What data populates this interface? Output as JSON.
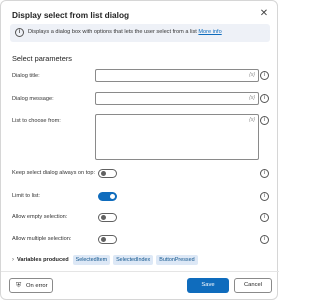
{
  "dialog": {
    "title": "Display select from list dialog",
    "close_icon": "close-icon"
  },
  "banner": {
    "icon": "info-icon",
    "text": "Displays a dialog box with options that lets the user select from a list",
    "link": "More info"
  },
  "section_title": "Select parameters",
  "fields": {
    "dialog_title": {
      "label": "Dialog title:",
      "value": "",
      "fx": "{x}"
    },
    "dialog_message": {
      "label": "Dialog message:",
      "value": "",
      "fx": "{x}"
    },
    "list": {
      "label": "List to choose from:",
      "value": "",
      "fx": "{x}"
    }
  },
  "toggles": {
    "keep_on_top": {
      "label": "Keep select dialog always on top:",
      "on": false
    },
    "limit_to_list": {
      "label": "Limit to list:",
      "on": true
    },
    "allow_empty": {
      "label": "Allow empty selection:",
      "on": false
    },
    "allow_multiple": {
      "label": "Allow multiple selection:",
      "on": false
    }
  },
  "help_icon": "i",
  "variables": {
    "label": "Variables produced",
    "chips": [
      "SelectedItem",
      "SelectedIndex",
      "ButtonPressed"
    ]
  },
  "footer": {
    "on_error": "On error",
    "save": "Save",
    "cancel": "Cancel"
  },
  "colors": {
    "accent": "#0f6cbd",
    "banner_bg": "#eef1f7",
    "chip_bg": "#dde8f6"
  }
}
